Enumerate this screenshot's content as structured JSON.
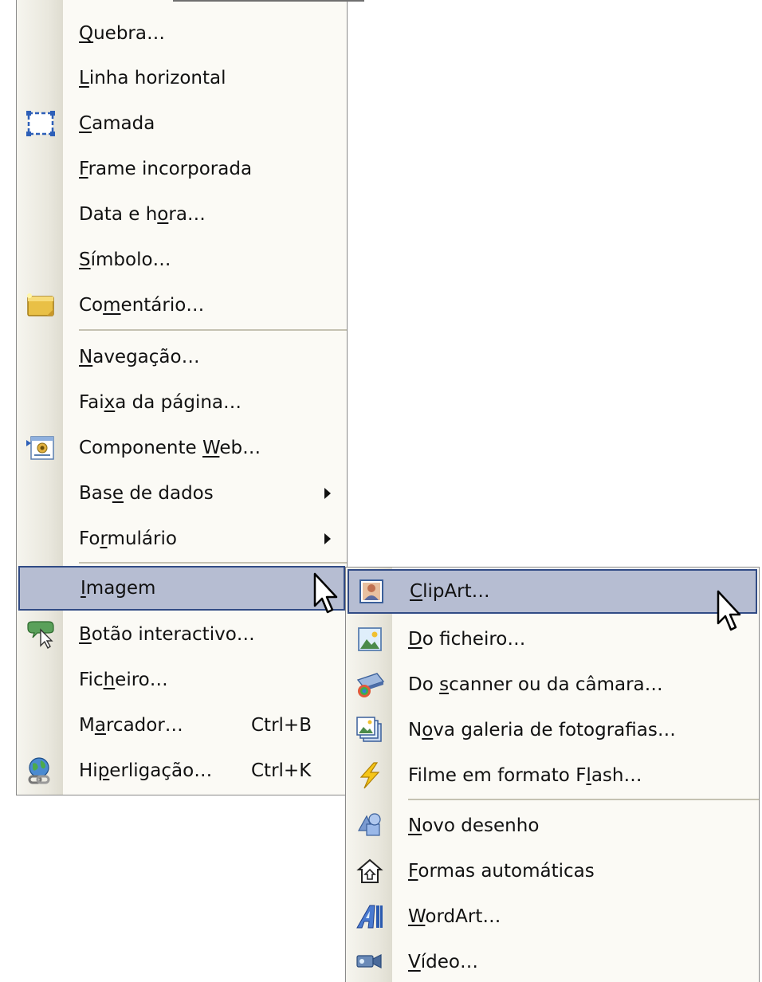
{
  "main_menu": {
    "items": [
      {
        "pre": "",
        "ul": "Q",
        "post": "uebra…"
      },
      {
        "pre": "",
        "ul": "L",
        "post": "inha horizontal"
      },
      {
        "pre": "",
        "ul": "C",
        "post": "amada",
        "icon": "layer-icon"
      },
      {
        "pre": "",
        "ul": "F",
        "post": "rame incorporada"
      },
      {
        "pre": "Data e h",
        "ul": "o",
        "post": "ra…"
      },
      {
        "pre": "",
        "ul": "S",
        "post": "ímbolo…"
      },
      {
        "pre": "Co",
        "ul": "m",
        "post": "entário…",
        "icon": "comment-icon"
      },
      {
        "pre": "",
        "ul": "N",
        "post": "avegação…"
      },
      {
        "pre": "Fai",
        "ul": "x",
        "post": "a da página…"
      },
      {
        "pre": "Componente ",
        "ul": "W",
        "post": "eb…",
        "icon": "web-component-icon"
      },
      {
        "pre": "Bas",
        "ul": "e",
        "post": " de dados",
        "submenu": true
      },
      {
        "pre": "Fo",
        "ul": "r",
        "post": "mulário",
        "submenu": true
      },
      {
        "pre": "",
        "ul": "I",
        "post": "magem",
        "submenu": true,
        "highlight": true
      },
      {
        "pre": "",
        "ul": "B",
        "post": "otão interactivo…",
        "icon": "interactive-button-icon"
      },
      {
        "pre": "Fic",
        "ul": "h",
        "post": "eiro…"
      },
      {
        "pre": "M",
        "ul": "a",
        "post": "rcador…",
        "shortcut": "Ctrl+B"
      },
      {
        "pre": "Hi",
        "ul": "p",
        "post": "erligação…",
        "shortcut": "Ctrl+K",
        "icon": "hyperlink-icon"
      }
    ]
  },
  "sub_menu": {
    "items": [
      {
        "pre": "",
        "ul": "C",
        "post": "lipArt…",
        "icon": "clipart-icon",
        "highlight": true
      },
      {
        "pre": "",
        "ul": "D",
        "post": "o ficheiro…",
        "icon": "picture-file-icon"
      },
      {
        "pre": "Do ",
        "ul": "s",
        "post": "canner ou da câmara…",
        "icon": "scanner-icon"
      },
      {
        "pre": "N",
        "ul": "o",
        "post": "va galeria de fotografias…",
        "icon": "photo-gallery-icon"
      },
      {
        "pre": "Filme em formato F",
        "ul": "l",
        "post": "ash…",
        "icon": "flash-icon"
      },
      {
        "pre": "",
        "ul": "N",
        "post": "ovo desenho",
        "icon": "new-drawing-icon"
      },
      {
        "pre": "",
        "ul": "F",
        "post": "ormas automáticas",
        "icon": "autoshapes-icon"
      },
      {
        "pre": "",
        "ul": "W",
        "post": "ordArt…",
        "icon": "wordart-icon"
      },
      {
        "pre": "",
        "ul": "V",
        "post": "ídeo…",
        "icon": "video-icon"
      }
    ]
  },
  "colors": {
    "highlight_fill": "#b6bdd2",
    "highlight_border": "#314b85",
    "menu_background": "#fbfaf5",
    "icon_column": "#e9e7dd"
  }
}
